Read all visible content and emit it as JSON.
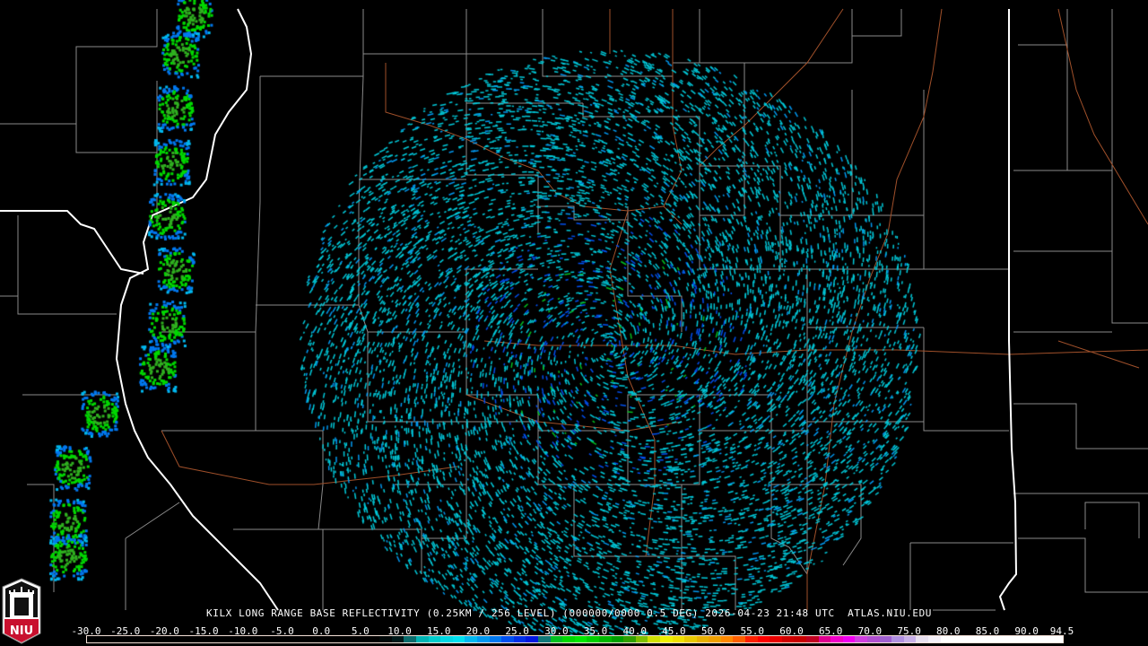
{
  "caption": {
    "station": "KILX",
    "product": "LONG RANGE BASE REFLECTIVITY",
    "resolution": "(0.25KM / 256 LEVEL)",
    "scan": "(000000/0000 0.5 DEG)",
    "date": "2026-04-23",
    "time": "21:48 UTC",
    "site": "ATLAS.NIU.EDU"
  },
  "logo": {
    "text": "NIU",
    "color": "#c8102e"
  },
  "colorbar": {
    "min": -30.0,
    "max": 94.5,
    "ticks": [
      "-30.0",
      "-25.0",
      "-20.0",
      "-15.0",
      "-10.0",
      "-5.0",
      "0.0",
      "5.0",
      "10.0",
      "15.0",
      "20.0",
      "25.0",
      "30.0",
      "35.0",
      "40.0",
      "45.0",
      "50.0",
      "55.0",
      "60.0",
      "65.0",
      "70.0",
      "75.0",
      "80.0",
      "85.0",
      "90.0",
      "94.5"
    ],
    "colors": [
      "#000000",
      "#000000",
      "#000000",
      "#000000",
      "#000000",
      "#000000",
      "#000000",
      "#000000",
      "#000000",
      "#000000",
      "#000000",
      "#000000",
      "#000000",
      "#000000",
      "#000000",
      "#000000",
      "#000000",
      "#000000",
      "#000000",
      "#000000",
      "#000000",
      "#000000",
      "#000000",
      "#000000",
      "#000808",
      "#001a1a",
      "#0a6c6c",
      "#00b4b4",
      "#00cccc",
      "#00d8e4",
      "#00e0f0",
      "#00b8f0",
      "#0098f0",
      "#0078f0",
      "#0050f0",
      "#0030e8",
      "#0018e0",
      "#107878",
      "#00c020",
      "#00d800",
      "#00e800",
      "#00d000",
      "#00b800",
      "#00a000",
      "#30a000",
      "#80c000",
      "#d0e000",
      "#f0f000",
      "#f0e000",
      "#e8c800",
      "#e8b000",
      "#f0a000",
      "#ff8800",
      "#ff6000",
      "#ff2000",
      "#ff0000",
      "#e80000",
      "#d00000",
      "#c80000",
      "#c00020",
      "#e00090",
      "#f000c8",
      "#f000f0",
      "#d040e0",
      "#b050d0",
      "#a060d0",
      "#b090e0",
      "#c8b0e8",
      "#e8e0f0",
      "#f4f0f8",
      "#ffffff",
      "#ffffff",
      "#ffffff",
      "#ffffff",
      "#ffffff",
      "#ffffff",
      "#ffffff",
      "#ffffff",
      "#ffffff",
      "#ffffff"
    ]
  }
}
